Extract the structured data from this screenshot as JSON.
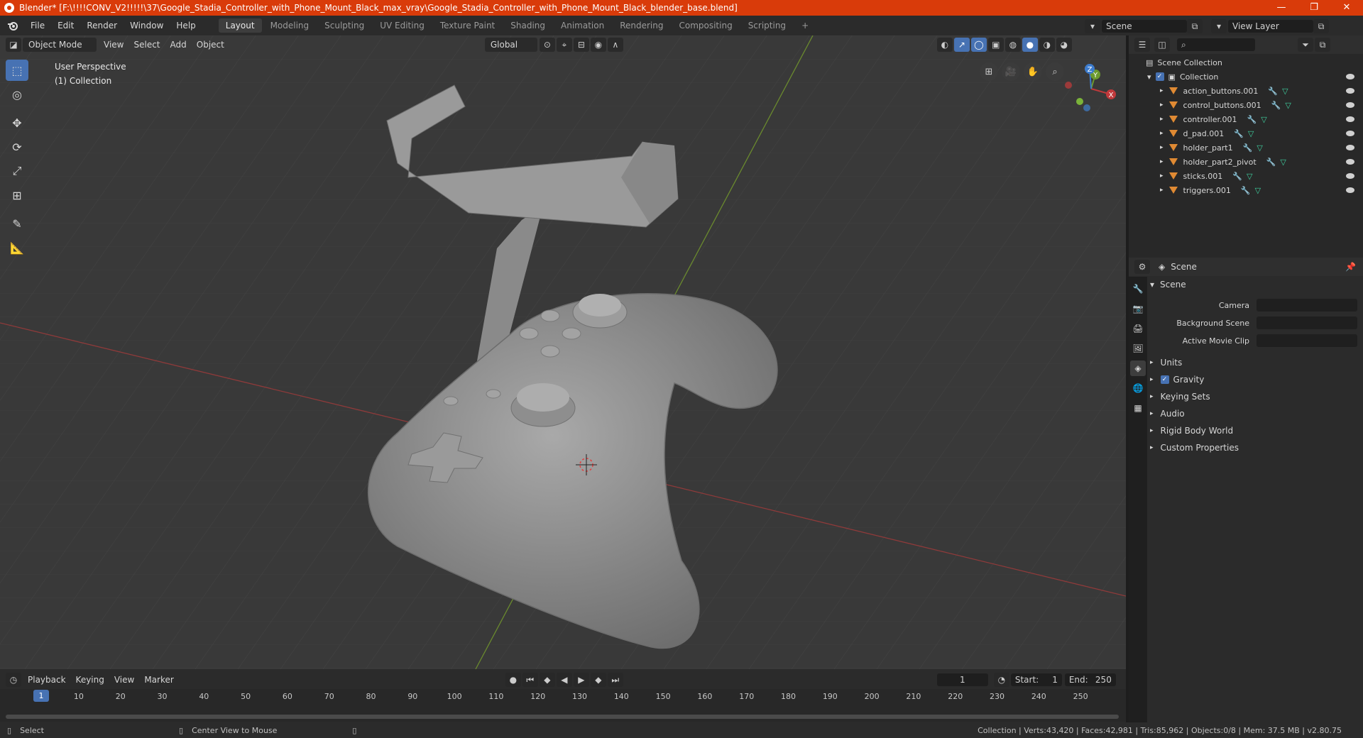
{
  "window": {
    "title": "Blender* [F:\\!!!!CONV_V2!!!!!\\37\\Google_Stadia_Controller_with_Phone_Mount_Black_max_vray\\Google_Stadia_Controller_with_Phone_Mount_Black_blender_base.blend]",
    "controls": [
      "—",
      "❐",
      "✕"
    ]
  },
  "menubar": {
    "menus": [
      "File",
      "Edit",
      "Render",
      "Window",
      "Help"
    ],
    "workspaces": [
      "Layout",
      "Modeling",
      "Sculpting",
      "UV Editing",
      "Texture Paint",
      "Shading",
      "Animation",
      "Rendering",
      "Compositing",
      "Scripting"
    ],
    "active_workspace": "Layout",
    "add_workspace": "+",
    "scene_name": "Scene",
    "view_layer": "View Layer"
  },
  "viewport": {
    "mode": "Object Mode",
    "menus": [
      "View",
      "Select",
      "Add",
      "Object"
    ],
    "orientation": "Global",
    "perspective_label": "User Perspective",
    "collection_label": "(1) Collection",
    "gizmo_axes": {
      "x": "X",
      "y": "Y",
      "z": "Z"
    }
  },
  "timeline": {
    "menus": [
      "Playback",
      "Keying",
      "View",
      "Marker"
    ],
    "current_frame": "1",
    "start_label": "Start:",
    "start": "1",
    "end_label": "End:",
    "end": "250",
    "ticks": [
      "10",
      "20",
      "30",
      "40",
      "50",
      "60",
      "70",
      "80",
      "90",
      "100",
      "110",
      "120",
      "130",
      "140",
      "150",
      "160",
      "170",
      "180",
      "190",
      "200",
      "210",
      "220",
      "230",
      "240",
      "250"
    ]
  },
  "statusbar": {
    "left_action": "Select",
    "middle_action": "Center View to Mouse",
    "stats": "Collection | Verts:43,420 | Faces:42,981 | Tris:85,962 | Objects:0/8 | Mem: 37.5 MB | v2.80.75"
  },
  "outliner": {
    "root": "Scene Collection",
    "collection": "Collection",
    "objects": [
      "action_buttons.001",
      "control_buttons.001",
      "controller.001",
      "d_pad.001",
      "holder_part1",
      "holder_part2_pivot",
      "sticks.001",
      "triggers.001"
    ]
  },
  "properties": {
    "context": "Scene",
    "panel_title": "Scene",
    "fields": {
      "camera": "Camera",
      "background_scene": "Background Scene",
      "active_movie_clip": "Active Movie Clip"
    },
    "sections": [
      "Units",
      "Gravity",
      "Keying Sets",
      "Audio",
      "Rigid Body World",
      "Custom Properties"
    ],
    "gravity_enabled": true
  },
  "colors": {
    "accent": "#4772b3",
    "titlebar": "#d93b0a",
    "x_axis": "#c0393b",
    "y_axis": "#6c9a2f",
    "z_axis": "#3d7ccd"
  }
}
